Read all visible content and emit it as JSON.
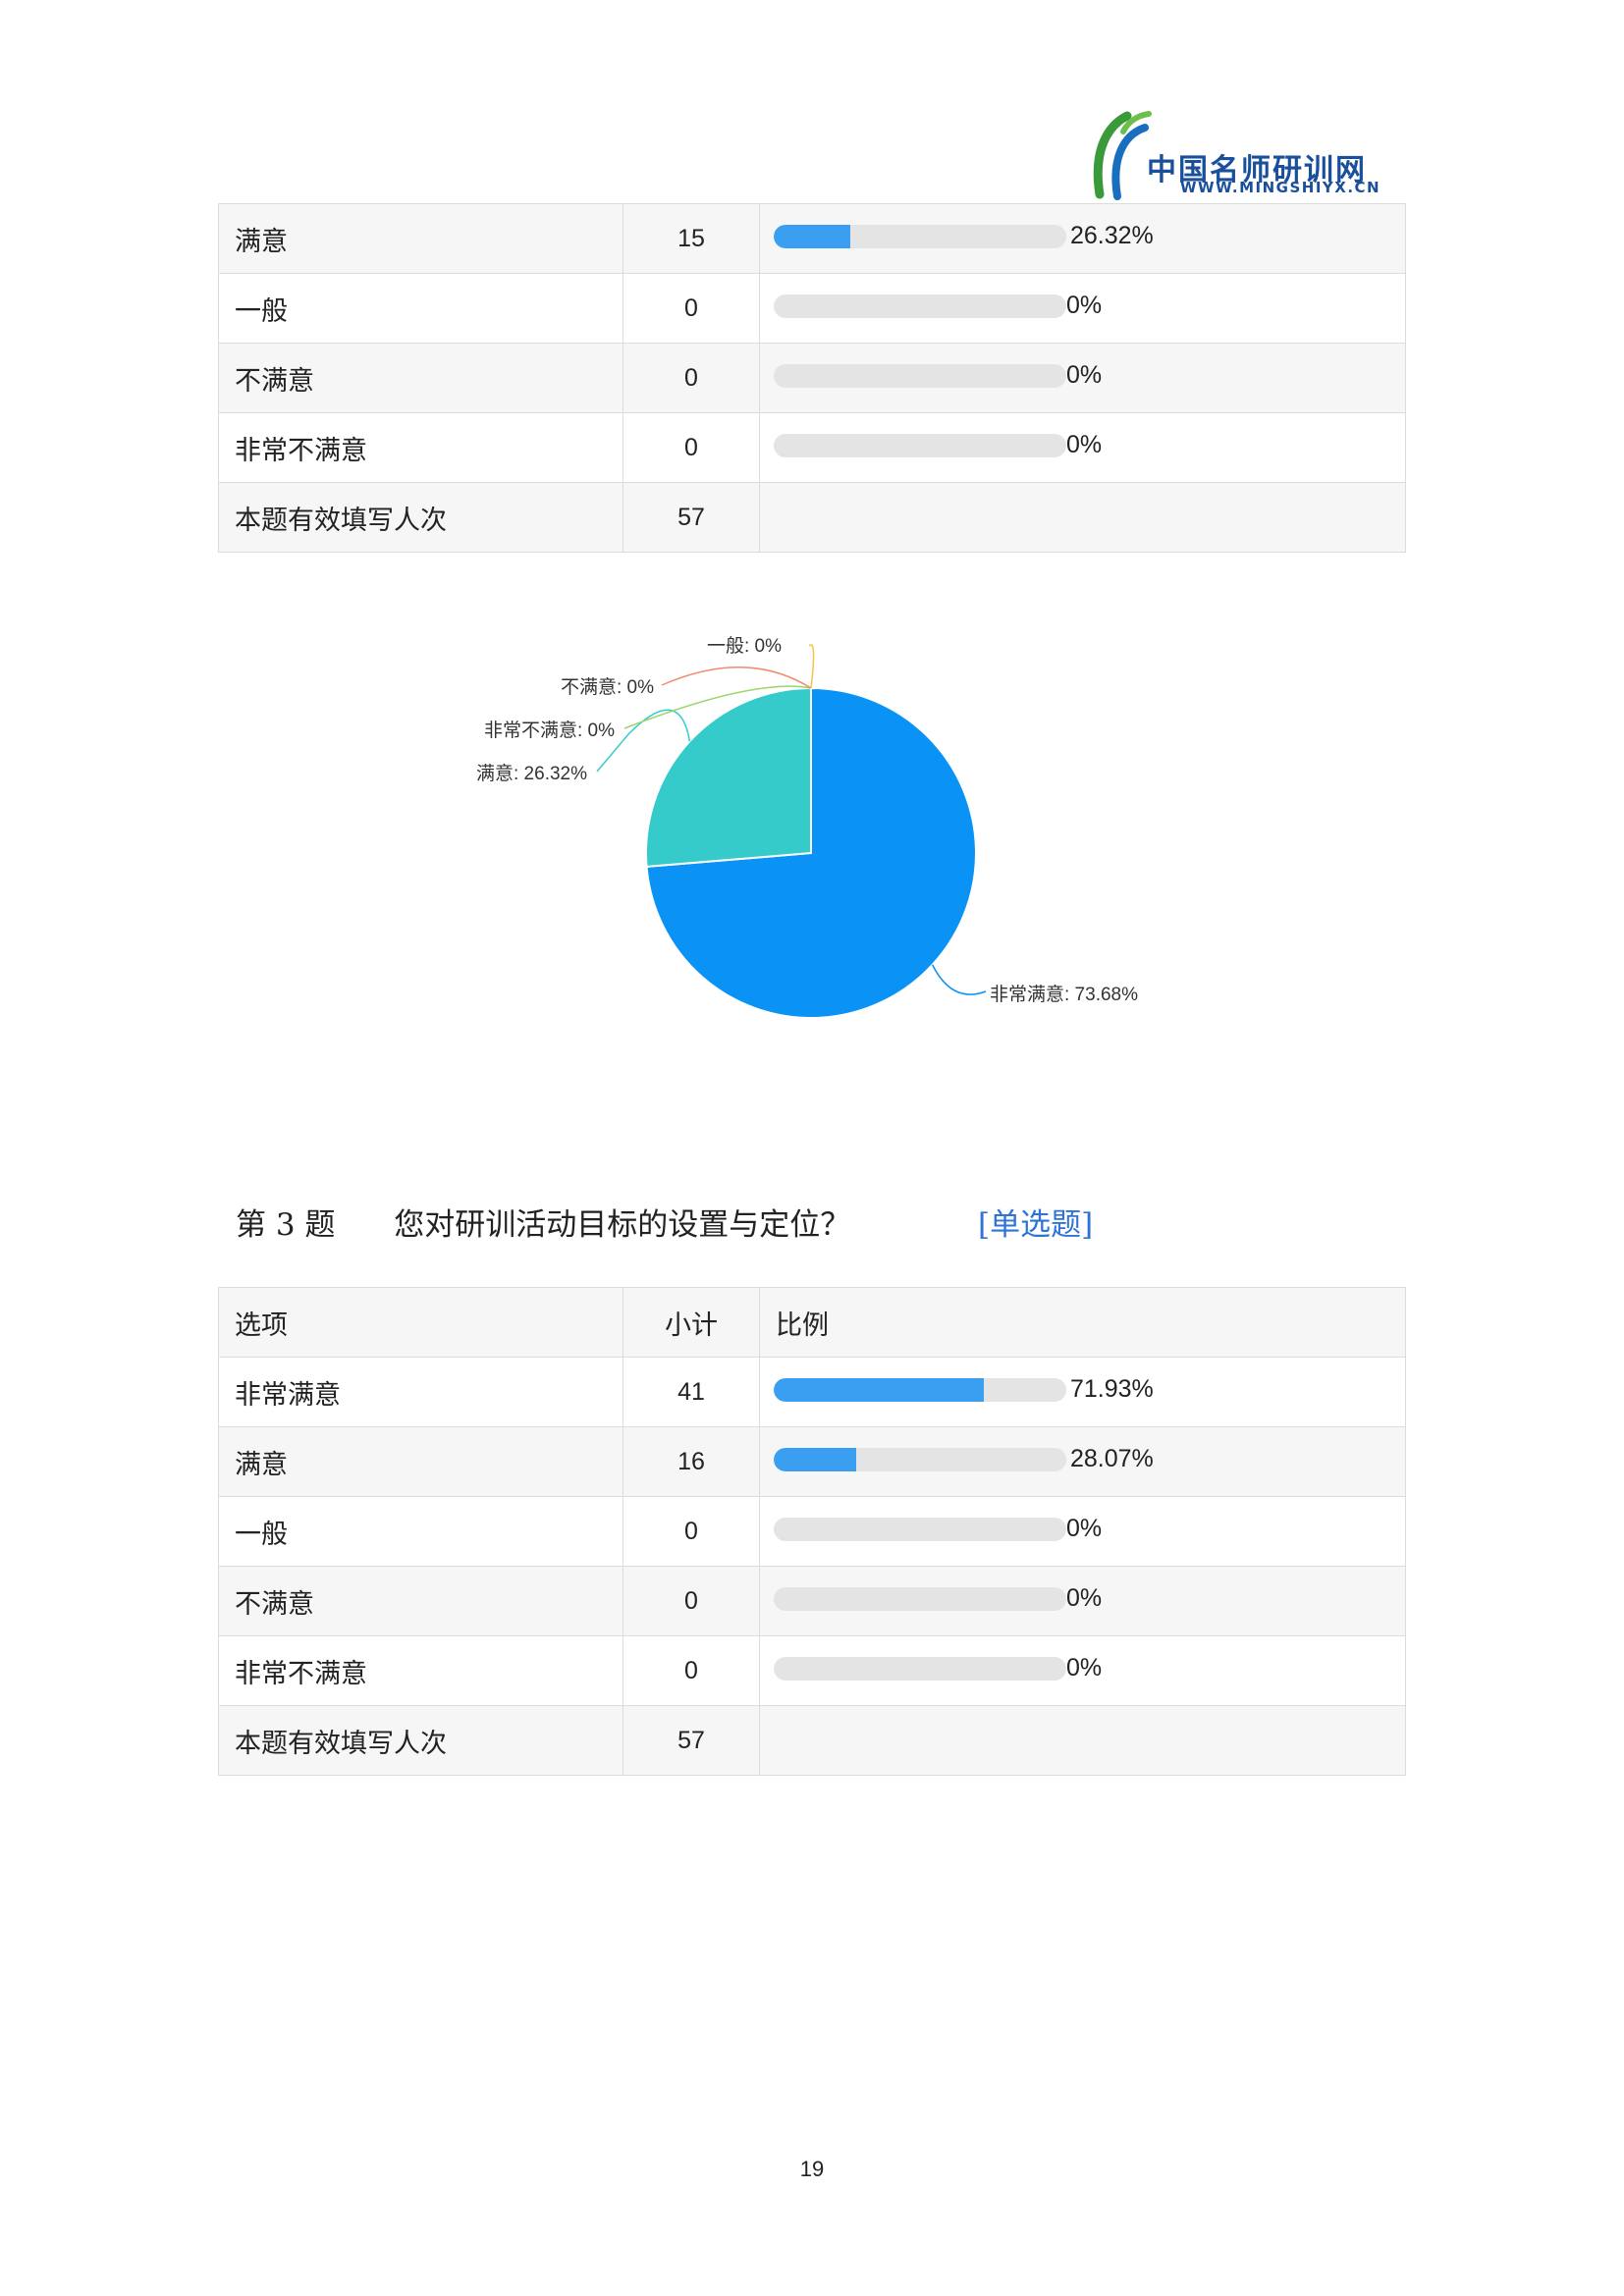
{
  "logo": {
    "title": "中国名师研训网",
    "url": "WWW.MINGSHIYX.CN"
  },
  "table1": {
    "rows": [
      {
        "option": "满意",
        "count": "15",
        "percent_label": "26.32%",
        "percent": 26.32
      },
      {
        "option": "一般",
        "count": "0",
        "percent_label": "0%",
        "percent": 0
      },
      {
        "option": "不满意",
        "count": "0",
        "percent_label": "0%",
        "percent": 0
      },
      {
        "option": "非常不满意",
        "count": "0",
        "percent_label": "0%",
        "percent": 0
      }
    ],
    "total": {
      "label": "本题有效填写人次",
      "count": "57"
    }
  },
  "chart_data": {
    "type": "pie",
    "slices": [
      {
        "label": "非常满意",
        "value": 73.68,
        "display": "非常满意: 73.68%",
        "color": "#0a93f5"
      },
      {
        "label": "满意",
        "value": 26.32,
        "display": "满意: 26.32%",
        "color": "#36cbcb"
      },
      {
        "label": "非常不满意",
        "value": 0,
        "display": "非常不满意: 0%",
        "color": "#9bd46a"
      },
      {
        "label": "不满意",
        "value": 0,
        "display": "不满意: 0%",
        "color": "#f28b6d"
      },
      {
        "label": "一般",
        "value": 0,
        "display": "一般: 0%",
        "color": "#f5c34a"
      }
    ]
  },
  "question3": {
    "number": "第 3 题",
    "text": "您对研训活动目标的设置与定位？",
    "type": "[单选题]"
  },
  "table2": {
    "header": {
      "option": "选项",
      "count": "小计",
      "ratio": "比例"
    },
    "rows": [
      {
        "option": "非常满意",
        "count": "41",
        "percent_label": "71.93%",
        "percent": 71.93
      },
      {
        "option": "满意",
        "count": "16",
        "percent_label": "28.07%",
        "percent": 28.07
      },
      {
        "option": "一般",
        "count": "0",
        "percent_label": "0%",
        "percent": 0
      },
      {
        "option": "不满意",
        "count": "0",
        "percent_label": "0%",
        "percent": 0
      },
      {
        "option": "非常不满意",
        "count": "0",
        "percent_label": "0%",
        "percent": 0
      }
    ],
    "total": {
      "label": "本题有效填写人次",
      "count": "57"
    }
  },
  "page_number": "19",
  "colors": {
    "bar_fill": "#3a9ff0",
    "bar_track": "#e4e4e4",
    "question_type": "#2e73d8"
  }
}
